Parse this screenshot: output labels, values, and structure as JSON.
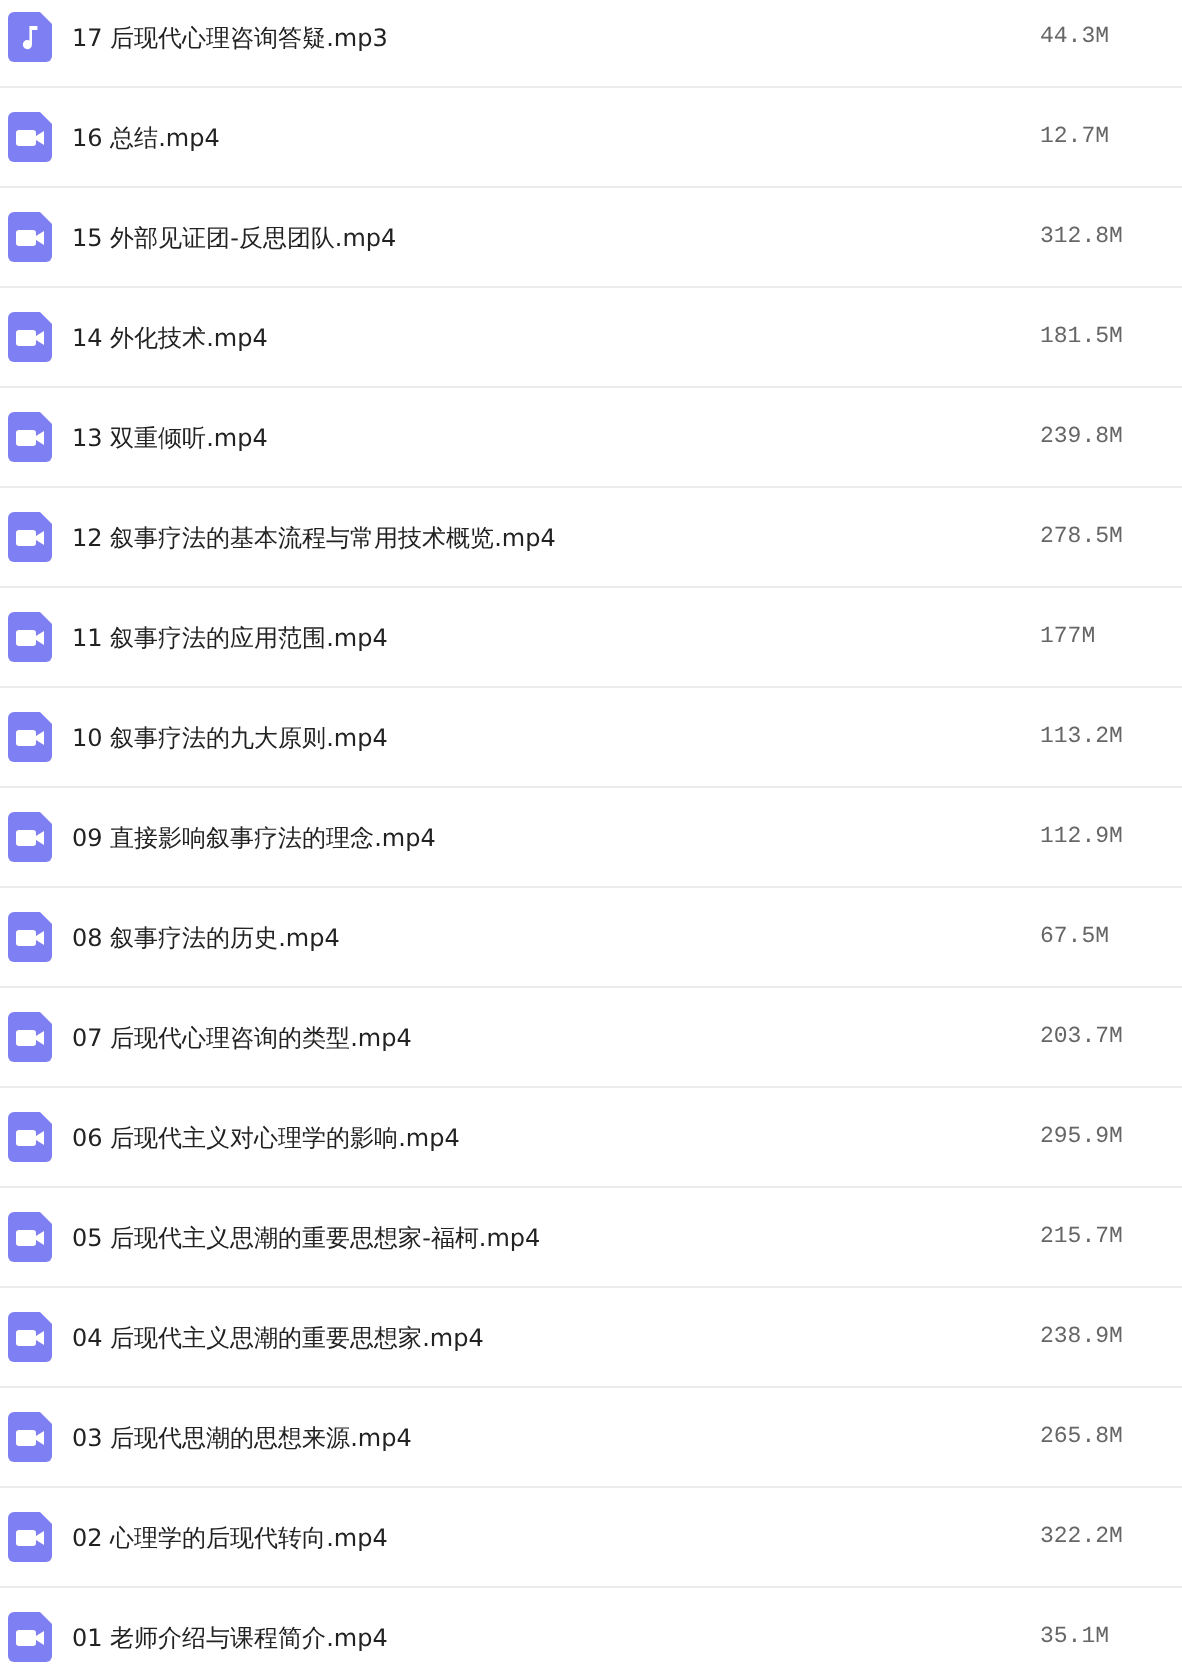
{
  "files": [
    {
      "kind": "audio",
      "name": "17 后现代心理咨询答疑.mp3",
      "size": "44.3M"
    },
    {
      "kind": "video",
      "name": "16 总结.mp4",
      "size": "12.7M"
    },
    {
      "kind": "video",
      "name": "15 外部见证团-反思团队.mp4",
      "size": "312.8M"
    },
    {
      "kind": "video",
      "name": "14 外化技术.mp4",
      "size": "181.5M"
    },
    {
      "kind": "video",
      "name": "13 双重倾听.mp4",
      "size": "239.8M"
    },
    {
      "kind": "video",
      "name": "12 叙事疗法的基本流程与常用技术概览.mp4",
      "size": "278.5M"
    },
    {
      "kind": "video",
      "name": "11 叙事疗法的应用范围.mp4",
      "size": "177M"
    },
    {
      "kind": "video",
      "name": "10 叙事疗法的九大原则.mp4",
      "size": "113.2M"
    },
    {
      "kind": "video",
      "name": "09 直接影响叙事疗法的理念.mp4",
      "size": "112.9M"
    },
    {
      "kind": "video",
      "name": "08 叙事疗法的历史.mp4",
      "size": "67.5M"
    },
    {
      "kind": "video",
      "name": "07 后现代心理咨询的类型.mp4",
      "size": "203.7M"
    },
    {
      "kind": "video",
      "name": "06 后现代主义对心理学的影响.mp4",
      "size": "295.9M"
    },
    {
      "kind": "video",
      "name": "05 后现代主义思潮的重要思想家-福柯.mp4",
      "size": "215.7M"
    },
    {
      "kind": "video",
      "name": "04 后现代主义思潮的重要思想家.mp4",
      "size": "238.9M"
    },
    {
      "kind": "video",
      "name": "03 后现代思潮的思想来源.mp4",
      "size": "265.8M"
    },
    {
      "kind": "video",
      "name": "02 心理学的后现代转向.mp4",
      "size": "322.2M"
    },
    {
      "kind": "video",
      "name": "01 老师介绍与课程简介.mp4",
      "size": "35.1M"
    }
  ]
}
